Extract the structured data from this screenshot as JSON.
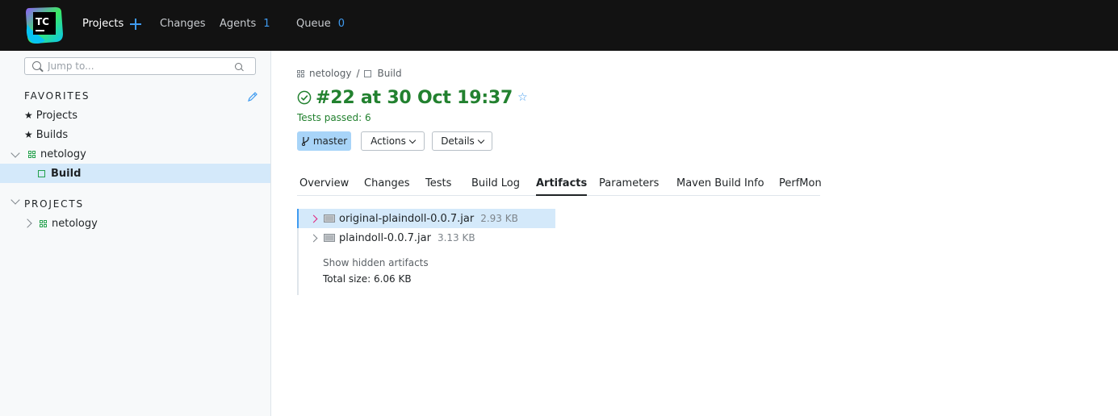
{
  "logo": {
    "text": "TC"
  },
  "header": {
    "nav": [
      {
        "label": "Projects"
      },
      {
        "label": "Changes"
      },
      {
        "label": "Agents",
        "count": "1"
      },
      {
        "label": "Queue",
        "count": "0"
      }
    ]
  },
  "sidebar": {
    "search_placeholder": "Jump to...",
    "favorites_title": "FAVORITES",
    "favorites": [
      {
        "label": "Projects"
      },
      {
        "label": "Builds"
      },
      {
        "label": "netology"
      },
      {
        "label": "Build"
      }
    ],
    "projects_title": "PROJECTS",
    "projects": [
      {
        "label": "netology"
      }
    ]
  },
  "breadcrumb": {
    "project": "netology",
    "sep": "/",
    "build_config": "Build"
  },
  "build": {
    "title": "#22 at 30 Oct 19:37",
    "tests_passed": "Tests passed: 6",
    "branch": "master",
    "actions_label": "Actions",
    "details_label": "Details"
  },
  "tabs": [
    {
      "label": "Overview"
    },
    {
      "label": "Changes"
    },
    {
      "label": "Tests"
    },
    {
      "label": "Build Log"
    },
    {
      "label": "Artifacts"
    },
    {
      "label": "Parameters"
    },
    {
      "label": "Maven Build Info"
    },
    {
      "label": "PerfMon"
    }
  ],
  "artifacts": {
    "items": [
      {
        "name": "original-plaindoll-0.0.7.jar",
        "size": "2.93 KB"
      },
      {
        "name": "plaindoll-0.0.7.jar",
        "size": "3.13 KB"
      }
    ],
    "show_hidden": "Show hidden artifacts",
    "total_size": "Total size: 6.06 KB"
  },
  "colors": {
    "header_bg": "#121212",
    "accent": "#3f9bf0",
    "success": "#22812f",
    "selection": "#d4e9fa"
  }
}
